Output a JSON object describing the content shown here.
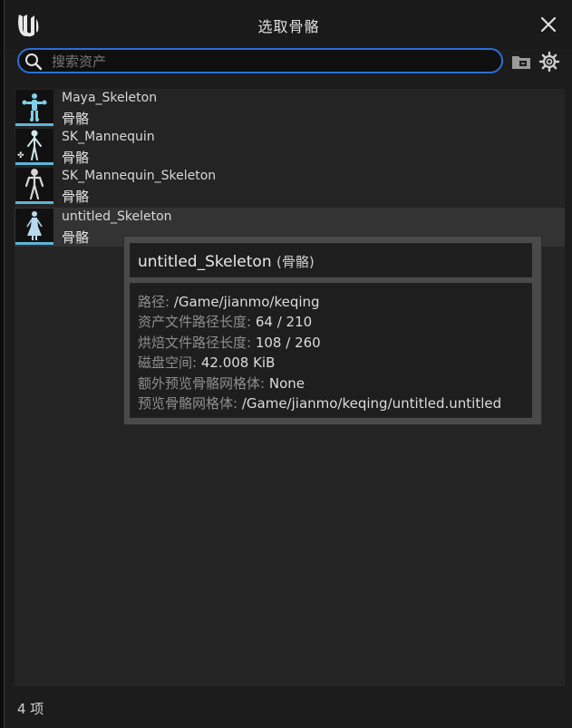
{
  "dialog": {
    "title": "选取骨骼",
    "icons": {
      "logo": "unreal-logo-icon",
      "close": "close-icon",
      "search": "search-icon",
      "folder": "folder-icon",
      "settings": "gear-icon"
    }
  },
  "search": {
    "placeholder": "搜索资产",
    "value": ""
  },
  "assets": [
    {
      "name": "Maya_Skeleton",
      "type": "骨骼"
    },
    {
      "name": "SK_Mannequin",
      "type": "骨骼",
      "badge": "✤"
    },
    {
      "name": "SK_Mannequin_Skeleton",
      "type": "骨骼"
    },
    {
      "name": "untitled_Skeleton",
      "type": "骨骼"
    }
  ],
  "tooltip": {
    "name": "untitled_Skeleton",
    "type": "(骨骼)",
    "rows": [
      {
        "key": "路径:",
        "value": "/Game/jianmo/keqing"
      },
      {
        "key": "资产文件路径长度:",
        "value": "64 / 210"
      },
      {
        "key": "烘焙文件路径长度:",
        "value": "108 / 260"
      },
      {
        "key": "磁盘空间:",
        "value": "42.008 KiB"
      },
      {
        "key": "额外预览骨骼网格体:",
        "value": "None"
      },
      {
        "key": "预览骨骼网格体:",
        "value": "/Game/jianmo/keqing/untitled.untitled"
      }
    ]
  },
  "footer": {
    "count": "4 项"
  },
  "colors": {
    "accent": "#2a6fd6",
    "thumb_underline": "#5fb4d8"
  }
}
